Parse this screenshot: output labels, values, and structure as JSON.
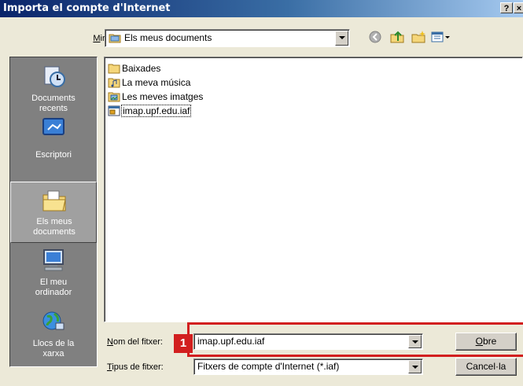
{
  "window": {
    "title": "Importa el compte d'Internet",
    "help_button": "?",
    "close_button": "×"
  },
  "look_in": {
    "label": "Mira a:",
    "value": "Els meus documents",
    "folder_icon": "folder-icon"
  },
  "toolbar": {
    "icons": [
      "back-icon",
      "up-folder-icon",
      "new-folder-icon",
      "views-menu-icon"
    ]
  },
  "places": [
    {
      "label_line1": "Documents",
      "label_line2": "recents",
      "icon": "recent-documents-icon",
      "selected": false
    },
    {
      "label_line1": "Escriptori",
      "label_line2": "",
      "icon": "desktop-icon",
      "selected": false
    },
    {
      "label_line1": "Els meus",
      "label_line2": "documents",
      "icon": "my-documents-icon",
      "selected": true
    },
    {
      "label_line1": "El meu",
      "label_line2": "ordinador",
      "icon": "my-computer-icon",
      "selected": false
    },
    {
      "label_line1": "Llocs de la",
      "label_line2": "xarxa",
      "icon": "network-places-icon",
      "selected": false
    }
  ],
  "files": [
    {
      "name": "Baixades",
      "icon": "folder-icon"
    },
    {
      "name": "La meva música",
      "icon": "music-folder-icon"
    },
    {
      "name": "Les meves imatges",
      "icon": "pictures-folder-icon"
    },
    {
      "name": "imap.upf.edu.iaf",
      "icon": "iaf-file-icon"
    }
  ],
  "filename": {
    "label": "Nom del fitxer:",
    "value": "imap.upf.edu.iaf"
  },
  "filetype": {
    "label": "Tipus de fitxer:",
    "value": "Fitxers de compte d'Internet (*.iaf)"
  },
  "buttons": {
    "open": "Obre",
    "cancel": "Cancel·la"
  },
  "annotation": {
    "number": "1",
    "color": "#d21f1f"
  }
}
